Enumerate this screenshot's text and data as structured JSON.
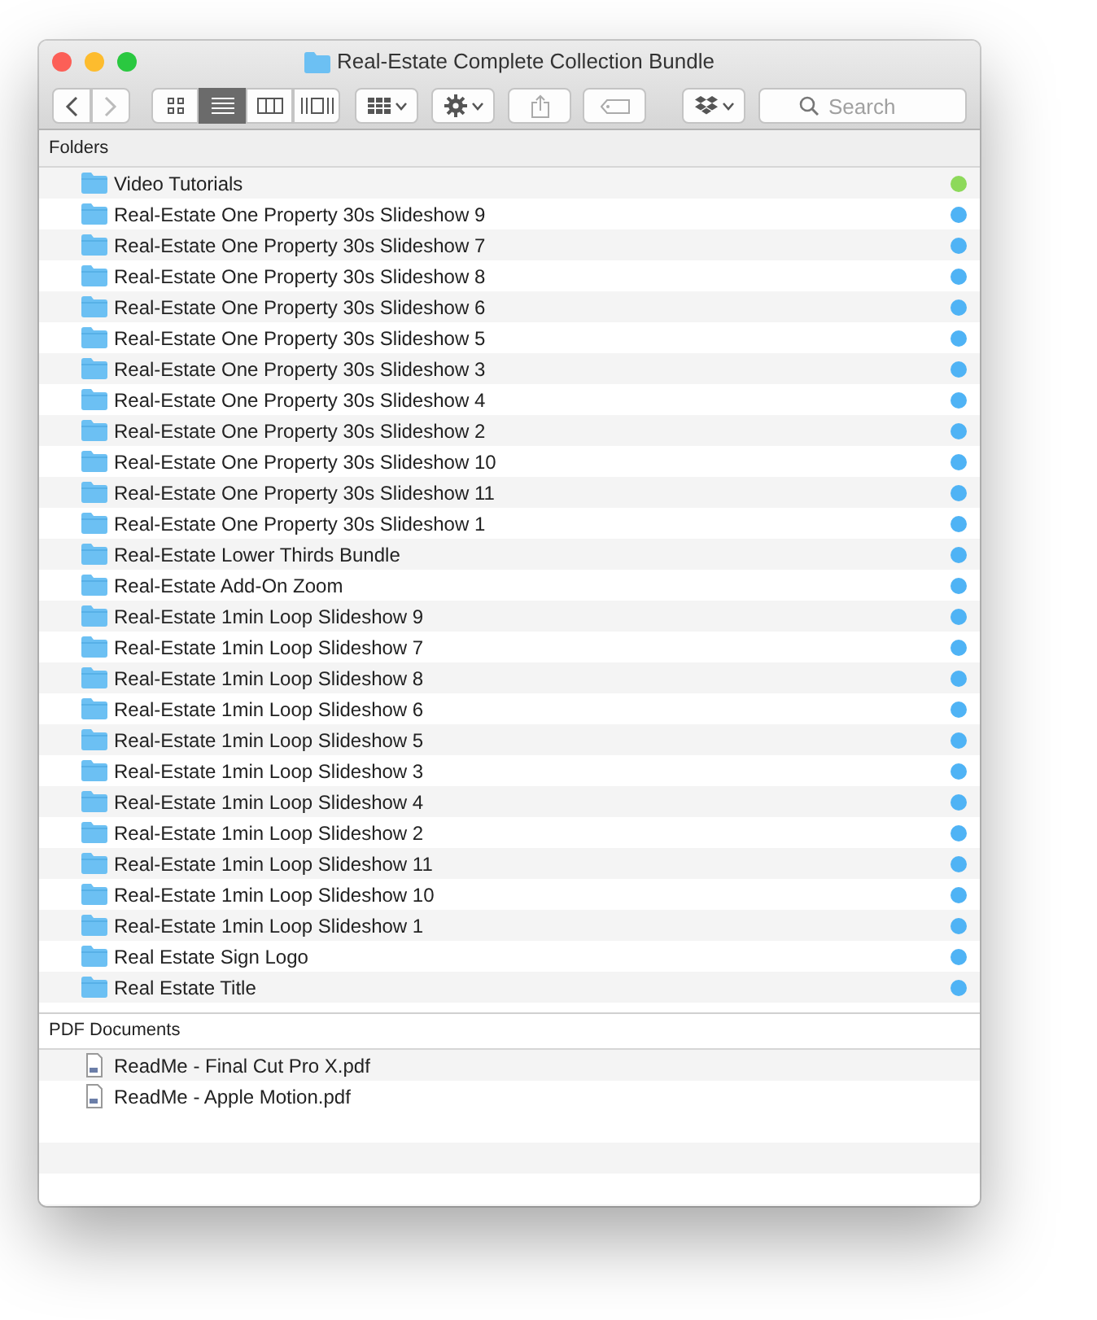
{
  "window": {
    "title": "Real-Estate Complete Collection Bundle"
  },
  "toolbar": {
    "view_modes": [
      {
        "kind": "icons",
        "selected": false
      },
      {
        "kind": "list",
        "selected": true
      },
      {
        "kind": "columns",
        "selected": false
      },
      {
        "kind": "gallery",
        "selected": false
      }
    ],
    "search": {
      "placeholder": "Search"
    }
  },
  "groups": [
    {
      "title": "Folders",
      "items": [
        {
          "kind": "folder",
          "name": "Video Tutorials",
          "color": "#8dd95a"
        },
        {
          "kind": "folder",
          "name": "Real-Estate One Property 30s Slideshow 9",
          "color": "#4fb3f5"
        },
        {
          "kind": "folder",
          "name": "Real-Estate One Property 30s Slideshow 7",
          "color": "#4fb3f5"
        },
        {
          "kind": "folder",
          "name": "Real-Estate One Property 30s Slideshow 8",
          "color": "#4fb3f5"
        },
        {
          "kind": "folder",
          "name": "Real-Estate One Property 30s Slideshow 6",
          "color": "#4fb3f5"
        },
        {
          "kind": "folder",
          "name": "Real-Estate One Property 30s Slideshow 5",
          "color": "#4fb3f5"
        },
        {
          "kind": "folder",
          "name": "Real-Estate One Property 30s Slideshow 3",
          "color": "#4fb3f5"
        },
        {
          "kind": "folder",
          "name": "Real-Estate One Property 30s Slideshow 4",
          "color": "#4fb3f5"
        },
        {
          "kind": "folder",
          "name": "Real-Estate One Property 30s Slideshow 2",
          "color": "#4fb3f5"
        },
        {
          "kind": "folder",
          "name": "Real-Estate One Property 30s Slideshow 10",
          "color": "#4fb3f5"
        },
        {
          "kind": "folder",
          "name": "Real-Estate One Property 30s Slideshow 11",
          "color": "#4fb3f5"
        },
        {
          "kind": "folder",
          "name": "Real-Estate One Property 30s Slideshow 1",
          "color": "#4fb3f5"
        },
        {
          "kind": "folder",
          "name": "Real-Estate Lower Thirds Bundle",
          "color": "#4fb3f5"
        },
        {
          "kind": "folder",
          "name": "Real-Estate Add-On Zoom",
          "color": "#4fb3f5"
        },
        {
          "kind": "folder",
          "name": "Real-Estate 1min Loop Slideshow 9",
          "color": "#4fb3f5"
        },
        {
          "kind": "folder",
          "name": "Real-Estate 1min Loop Slideshow 7",
          "color": "#4fb3f5"
        },
        {
          "kind": "folder",
          "name": "Real-Estate 1min Loop Slideshow 8",
          "color": "#4fb3f5"
        },
        {
          "kind": "folder",
          "name": "Real-Estate 1min Loop Slideshow 6",
          "color": "#4fb3f5"
        },
        {
          "kind": "folder",
          "name": "Real-Estate 1min Loop Slideshow 5",
          "color": "#4fb3f5"
        },
        {
          "kind": "folder",
          "name": "Real-Estate 1min Loop Slideshow 3",
          "color": "#4fb3f5"
        },
        {
          "kind": "folder",
          "name": "Real-Estate 1min Loop Slideshow 4",
          "color": "#4fb3f5"
        },
        {
          "kind": "folder",
          "name": "Real-Estate 1min Loop Slideshow 2",
          "color": "#4fb3f5"
        },
        {
          "kind": "folder",
          "name": "Real-Estate 1min Loop Slideshow 11",
          "color": "#4fb3f5"
        },
        {
          "kind": "folder",
          "name": "Real-Estate 1min Loop Slideshow 10",
          "color": "#4fb3f5"
        },
        {
          "kind": "folder",
          "name": "Real-Estate 1min Loop Slideshow 1",
          "color": "#4fb3f5"
        },
        {
          "kind": "folder",
          "name": "Real Estate Sign Logo",
          "color": "#4fb3f5"
        },
        {
          "kind": "folder",
          "name": "Real Estate Title",
          "color": "#4fb3f5"
        }
      ]
    },
    {
      "title": "PDF Documents",
      "items": [
        {
          "kind": "pdf",
          "name": "ReadMe - Final Cut Pro X.pdf"
        },
        {
          "kind": "pdf",
          "name": "ReadMe - Apple Motion.pdf"
        }
      ]
    }
  ]
}
